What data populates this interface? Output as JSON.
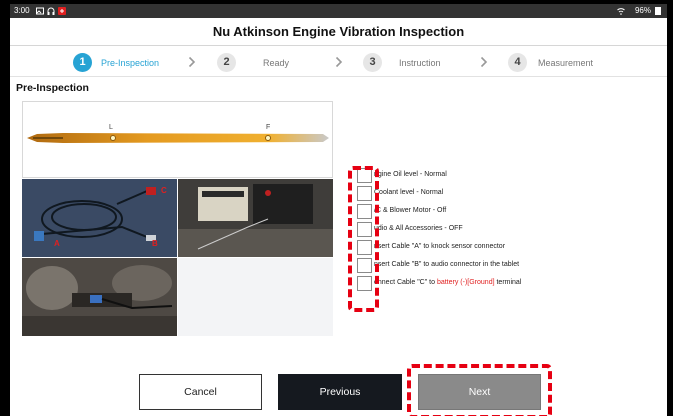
{
  "status_bar": {
    "time": "3:00",
    "battery": "96%"
  },
  "title": "Nu Atkinson Engine Vibration Inspection",
  "steps": [
    {
      "number": "1",
      "label": "Pre-Inspection",
      "active": true
    },
    {
      "number": "2",
      "label": "Ready",
      "active": false
    },
    {
      "number": "3",
      "label": "Instruction",
      "active": false
    },
    {
      "number": "4",
      "label": "Measurement",
      "active": false
    }
  ],
  "section_title": "Pre-Inspection",
  "images": {
    "dipstick": {
      "label_l": "L",
      "label_f": "F"
    },
    "cable": {
      "label_a": "A",
      "label_b": "B",
      "label_c": "C"
    }
  },
  "checklist": [
    {
      "text": "ngine Oil level - Normal"
    },
    {
      "text": "Coolant level - Normal"
    },
    {
      "text": "/C & Blower Motor - Off"
    },
    {
      "text": "udio & All Accessories - OFF"
    },
    {
      "text": "nsert Cable \"A\" to knock sensor connector"
    },
    {
      "text": "nsert Cable \"B\" to audio connector in the tablet"
    },
    {
      "text_before": "onnect Cable \"C\" to ",
      "text_highlight": "battery (-)[Ground]",
      "text_after": " terminal"
    }
  ],
  "buttons": {
    "cancel": "Cancel",
    "previous": "Previous",
    "next": "Next"
  },
  "colors": {
    "accent": "#27a3d4",
    "highlight_red": "#e60012",
    "previous_bg": "#15191f",
    "next_bg": "#8a8a8a"
  },
  "icons": [
    "image-icon",
    "headset-icon",
    "notification-icon",
    "wifi-icon",
    "battery-icon",
    "chevron-right-icon"
  ]
}
